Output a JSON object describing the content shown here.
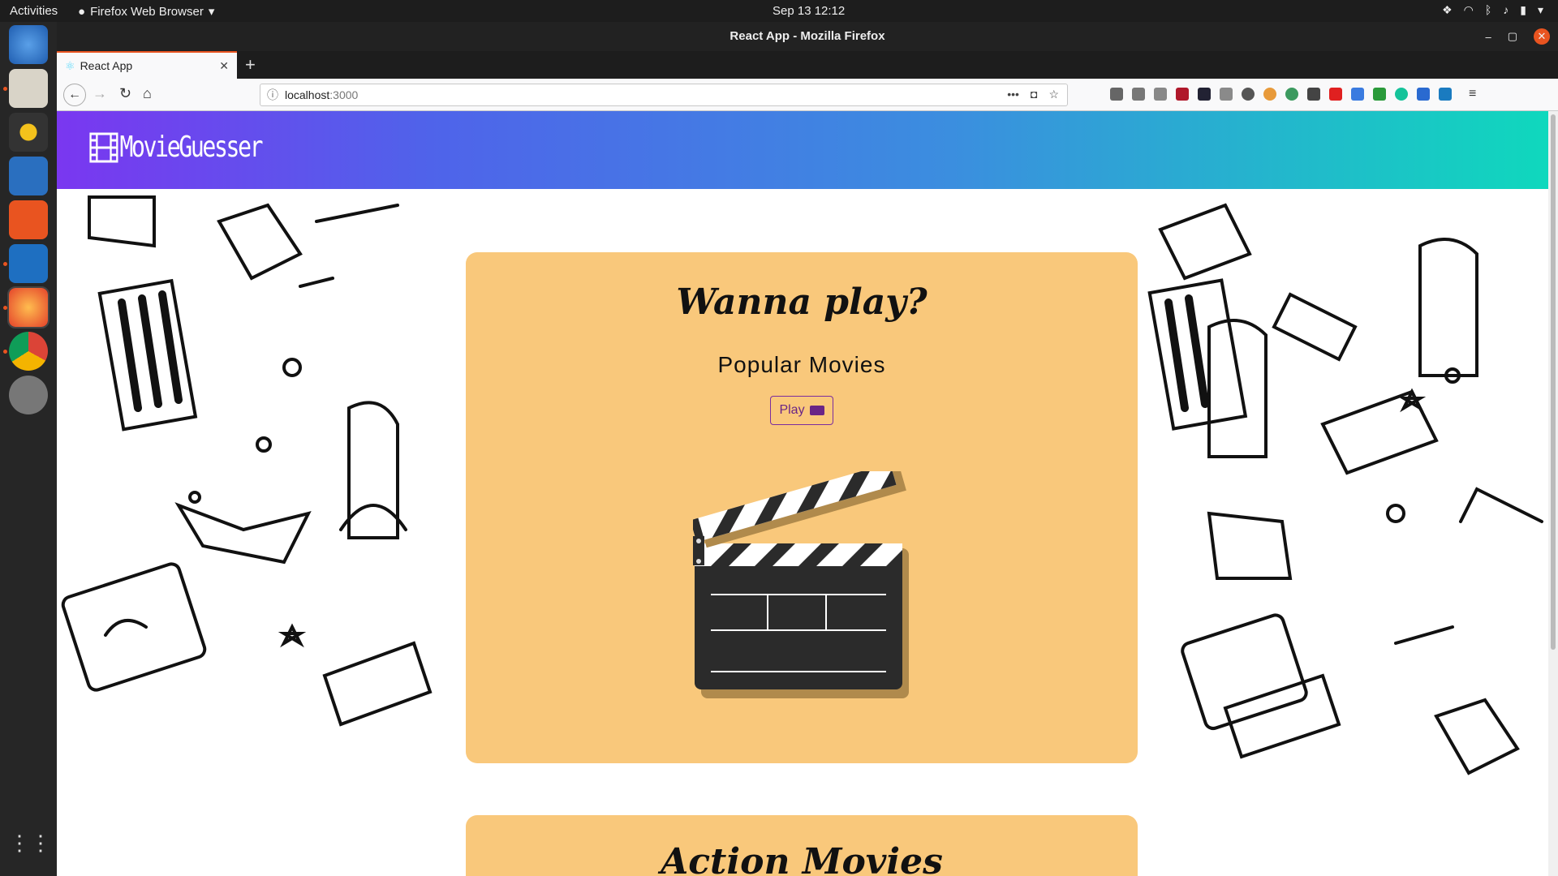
{
  "system": {
    "activities": "Activities",
    "app_menu": "Firefox Web Browser",
    "clock": "Sep 13  12:12"
  },
  "window": {
    "title": "React App - Mozilla Firefox"
  },
  "tab": {
    "title": "React App"
  },
  "address": {
    "host": "localhost",
    "port": ":3000"
  },
  "site": {
    "logo": "MovieGuesser"
  },
  "card1": {
    "title": "Wanna play?",
    "subtitle": "Popular Movies",
    "play_label": "Play"
  },
  "card2": {
    "title": "Action Movies"
  },
  "colors": {
    "card": "#f9c87b",
    "accent": "#7b2d9e",
    "header_start": "#7a37f0",
    "header_end": "#0fd8bd"
  },
  "icons": [
    "film-icon",
    "video-camera-icon",
    "clapperboard-icon"
  ]
}
